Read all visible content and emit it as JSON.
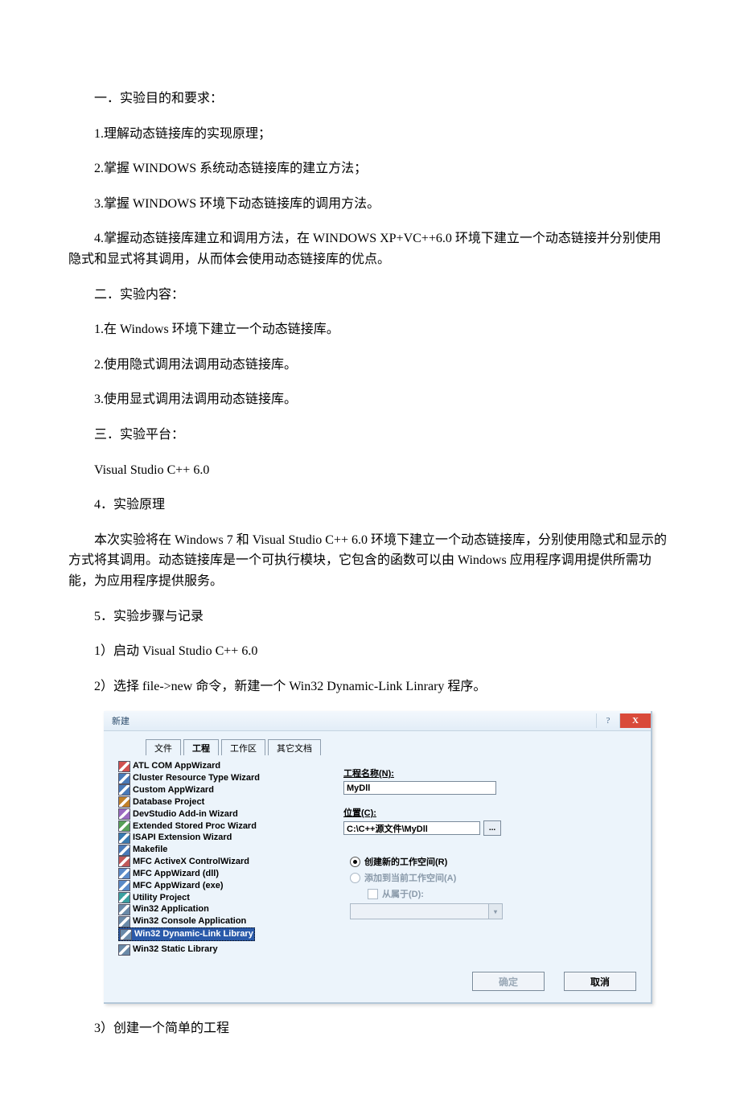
{
  "paragraphs": {
    "p1": "一．实验目的和要求：",
    "p2": "1.理解动态链接库的实现原理；",
    "p3": "2.掌握 WINDOWS 系统动态链接库的建立方法；",
    "p4": "3.掌握 WINDOWS 环境下动态链接库的调用方法。",
    "p5": "4.掌握动态链接库建立和调用方法，在 WINDOWS XP+VC++6.0 环境下建立一个动态链接并分别使用隐式和显式将其调用，从而体会使用动态链接库的优点。",
    "p6": "二．实验内容：",
    "p7": "1.在 Windows 环境下建立一个动态链接库。",
    "p8": "2.使用隐式调用法调用动态链接库。",
    "p9": "3.使用显式调用法调用动态链接库。",
    "p10": "三．实验平台：",
    "p11": "Visual Studio C++ 6.0",
    "p12": "4．实验原理",
    "p13": "本次实验将在 Windows 7 和 Visual Studio C++ 6.0 环境下建立一个动态链接库，分别使用隐式和显示的方式将其调用。动态链接库是一个可执行模块，它包含的函数可以由 Windows 应用程序调用提供所需功能，为应用程序提供服务。",
    "p14": "5．实验步骤与记录",
    "p15": "1）启动 Visual Studio C++ 6.0",
    "p16": "2）选择 file->new 命令，新建一个 Win32 Dynamic-Link Linrary 程序。",
    "p17": "3）创建一个简单的工程"
  },
  "dialog": {
    "title": "新建",
    "help_icon": "?",
    "close_icon": "X",
    "tabs": [
      "文件",
      "工程",
      "工作区",
      "其它文档"
    ],
    "active_tab": 1,
    "project_types": [
      "ATL COM AppWizard",
      "Cluster Resource Type Wizard",
      "Custom AppWizard",
      "Database Project",
      "DevStudio Add-in Wizard",
      "Extended Stored Proc Wizard",
      "ISAPI Extension Wizard",
      "Makefile",
      "MFC ActiveX ControlWizard",
      "MFC AppWizard (dll)",
      "MFC AppWizard (exe)",
      "Utility Project",
      "Win32 Application",
      "Win32 Console Application",
      "Win32 Dynamic-Link Library",
      "Win32 Static Library"
    ],
    "selected_type_index": 14,
    "labels": {
      "name": "工程名称(N):",
      "location": "位置(C):",
      "radio_new": "创建新的工作空间(R)",
      "radio_add": "添加到当前工作空间(A)",
      "checkbox_dep": "从属于(D):"
    },
    "name_value": "MyDll",
    "location_value": "C:\\C++源文件\\MyDll",
    "browse_icon": "...",
    "buttons": {
      "ok": "确定",
      "cancel": "取消"
    },
    "icon_colors": [
      "#d05050",
      "#4a7ab8",
      "#4a7ab8",
      "#c08028",
      "#9a6ac0",
      "#58a058",
      "#3a7ab0",
      "#4a7ab8",
      "#c05858",
      "#5a8ac8",
      "#5a8ac8",
      "#3aa0a0",
      "#6a8aa8",
      "#6a8aa8",
      "#6a8aa8",
      "#6a8aa8"
    ]
  }
}
